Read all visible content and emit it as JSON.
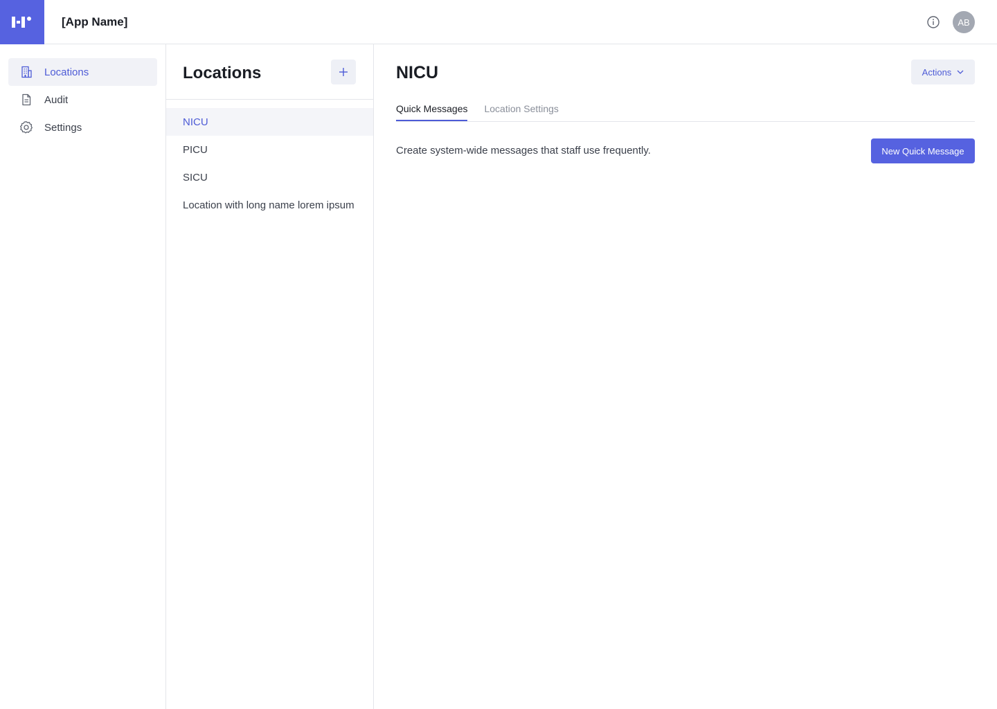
{
  "app": {
    "name": "[App Name]",
    "brand_color": "#5662e0",
    "logo_icon": "brand-logo-icon"
  },
  "header": {
    "info_icon": "info-circle-icon",
    "avatar_initials": "AB"
  },
  "sidebar": {
    "items": [
      {
        "label": "Locations",
        "icon": "building-icon",
        "active": true
      },
      {
        "label": "Audit",
        "icon": "document-icon",
        "active": false
      },
      {
        "label": "Settings",
        "icon": "gear-icon",
        "active": false
      }
    ]
  },
  "locations_panel": {
    "title": "Locations",
    "add_icon": "plus-icon",
    "items": [
      {
        "label": "NICU",
        "active": true
      },
      {
        "label": "PICU",
        "active": false
      },
      {
        "label": "SICU",
        "active": false
      },
      {
        "label": "Location with long name lorem ipsum",
        "active": false
      }
    ]
  },
  "main": {
    "title": "NICU",
    "actions_label": "Actions",
    "tabs": [
      {
        "label": "Quick Messages",
        "active": true
      },
      {
        "label": "Location Settings",
        "active": false
      }
    ],
    "description": "Create system-wide messages that staff use frequently.",
    "primary_button_label": "New Quick Message"
  },
  "colors": {
    "accent": "#4d5bd6",
    "active_bg": "#f1f2f7",
    "border": "#e3e5ea"
  }
}
